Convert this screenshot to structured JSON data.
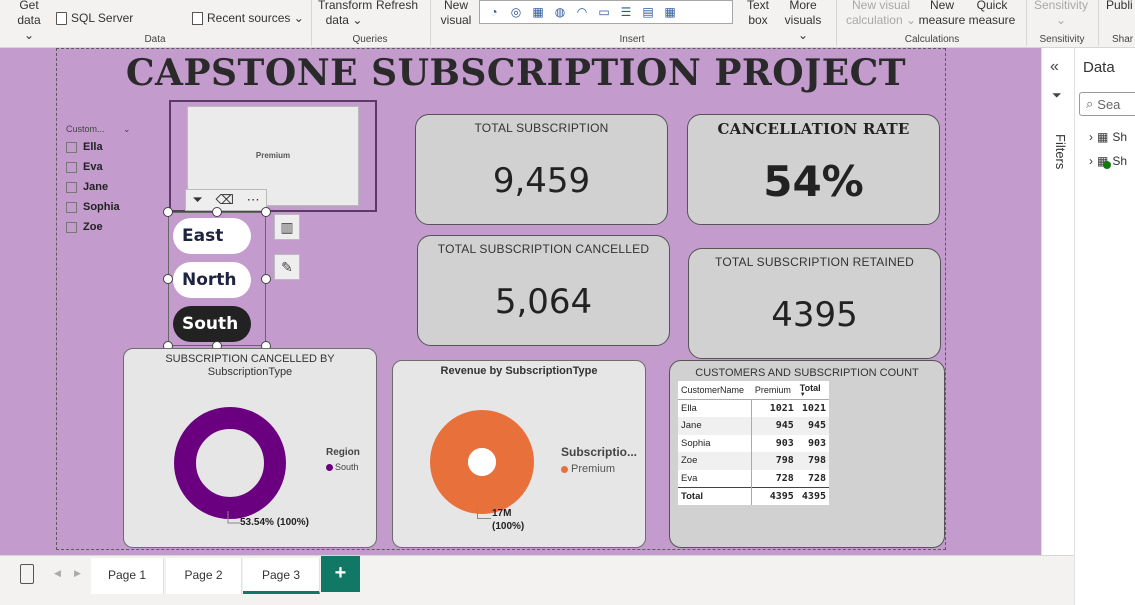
{
  "ribbon": {
    "get_data": [
      "Get",
      "data ⌄"
    ],
    "sql_server": "SQL Server",
    "recent_sources": "Recent sources ⌄",
    "transform_data": [
      "Transform",
      "data ⌄"
    ],
    "refresh": "Refresh",
    "new_visual": [
      "New",
      "visual"
    ],
    "text_box": [
      "Text",
      "box"
    ],
    "more_visuals": [
      "More",
      "visuals ⌄"
    ],
    "new_visual_calc": [
      "New visual",
      "calculation ⌄"
    ],
    "new_measure": [
      "New",
      "measure"
    ],
    "quick_measure": [
      "Quick",
      "measure"
    ],
    "sensitivity": "Sensitivity",
    "publish": "Publi",
    "groups": {
      "data": "Data",
      "queries": "Queries",
      "insert": "Insert",
      "calculations": "Calculations",
      "sensitivity": "Sensitivity",
      "share": "Shar"
    }
  },
  "report": {
    "title": "CAPSTONE SUBSCRIPTION PROJECT",
    "customer_slicer": {
      "header": "Custom...",
      "items": [
        "Ella",
        "Eva",
        "Jane",
        "Sophia",
        "Zoe"
      ]
    },
    "image_label": "Premium",
    "region_slicer": {
      "items": [
        {
          "label": "East",
          "selected": false
        },
        {
          "label": "North",
          "selected": false
        },
        {
          "label": "South",
          "selected": true
        }
      ]
    },
    "cards": {
      "total_subscription": {
        "title": "TOTAL SUBSCRIPTION",
        "value": "9,459"
      },
      "cancellation_rate": {
        "title": "CANCELLATION RATE",
        "value": "54%"
      },
      "total_cancelled": {
        "title": "TOTAL SUBSCRIPTION CANCELLED",
        "value": "5,064"
      },
      "total_retained": {
        "title": "TOTAL SUBSCRIPTION RETAINED",
        "value": "4395"
      }
    },
    "donut_chart": {
      "title_line1": "SUBSCRIPTION CANCELLED BY",
      "title_line2": "SubscriptionType",
      "legend_title": "Region",
      "legend_item": "South",
      "data_label": "53.54% (100%)"
    },
    "pie_chart": {
      "title": "Revenue by SubscriptionType",
      "legend_title": "Subscriptio...",
      "legend_item": "Premium",
      "data_label_line1": "17M",
      "data_label_line2": "(100%)"
    },
    "table": {
      "title": "CUSTOMERS AND SUBSCRIPTION COUNT",
      "columns": [
        "CustomerName",
        "Premium",
        "Total"
      ],
      "rows": [
        [
          "Ella",
          "1021",
          "1021"
        ],
        [
          "Jane",
          "945",
          "945"
        ],
        [
          "Sophia",
          "903",
          "903"
        ],
        [
          "Zoe",
          "798",
          "798"
        ],
        [
          "Eva",
          "728",
          "728"
        ]
      ],
      "total_row": [
        "Total",
        "4395",
        "4395"
      ]
    }
  },
  "panes": {
    "filters_label": "Filters",
    "data_title": "Data",
    "search_placeholder": "Sea",
    "table_items": [
      "Sh",
      "Sh"
    ]
  },
  "pages": {
    "tabs": [
      "Page 1",
      "Page 2",
      "Page 3"
    ],
    "active": "Page 3",
    "add_label": "+"
  },
  "chart_data": [
    {
      "type": "pie",
      "title": "SUBSCRIPTION CANCELLED BY SubscriptionType",
      "categories": [
        "South"
      ],
      "values": [
        53.54
      ],
      "legend_title": "Region",
      "legend": "right",
      "colors": [
        "#6a0080"
      ]
    },
    {
      "type": "pie",
      "title": "Revenue by SubscriptionType",
      "categories": [
        "Premium"
      ],
      "values": [
        17000000
      ],
      "legend_title": "Subscriptio...",
      "legend": "right",
      "colors": [
        "#e8703a"
      ]
    }
  ],
  "colors": {
    "canvas": "#c39bcd",
    "donut": "#6a0080",
    "pie": "#e8703a",
    "active_tab": "#117865"
  }
}
